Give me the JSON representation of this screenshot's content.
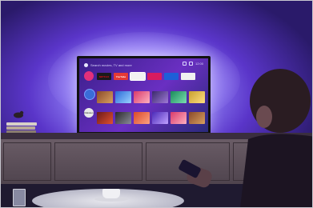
{
  "tv": {
    "search_text": "Search movies, TV and more",
    "time": "12:00",
    "apps": [
      "NETFLIX",
      "YouTube",
      "",
      "",
      ""
    ],
    "rakuten_label": "Rakuten"
  },
  "colors": {
    "wall_glow": "#b9b6ff",
    "ambilight": "#8a78f0",
    "screen_bg": "#6a2fc2",
    "netflix_red": "#e50914"
  }
}
